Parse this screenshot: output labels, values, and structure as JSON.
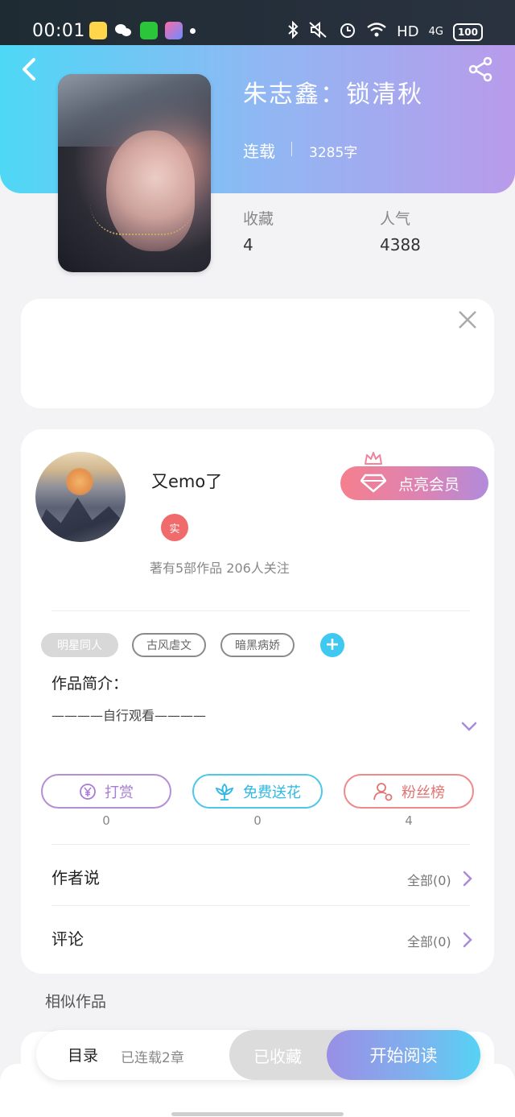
{
  "status_bar": {
    "time": "00:01",
    "network": "HD",
    "signal": "4G",
    "battery": "100"
  },
  "book": {
    "title": "朱志鑫：锁清秋",
    "status": "连载",
    "word_count": "3285字",
    "stats": [
      {
        "label": "收藏",
        "value": "4"
      },
      {
        "label": "人气",
        "value": "4388"
      }
    ]
  },
  "author": {
    "name": "又emo了",
    "badge": "实",
    "meta": "著有5部作品 206人关注",
    "vip_button": "点亮会员"
  },
  "tags": [
    "明星同人",
    "古风虐文",
    "暗黑病娇"
  ],
  "intro": {
    "label": "作品简介：",
    "text": "————自行观看————"
  },
  "actions": [
    {
      "label": "打赏",
      "count": "0",
      "icon": "yen-coin-icon"
    },
    {
      "label": "免费送花",
      "count": "0",
      "icon": "flower-icon"
    },
    {
      "label": "粉丝榜",
      "count": "4",
      "icon": "user-ranking-icon"
    }
  ],
  "rows": [
    {
      "label": "作者说",
      "all": "全部(0)"
    },
    {
      "label": "评论",
      "all": "全部(0)"
    }
  ],
  "similar_label": "相似作品",
  "bottom_bar": {
    "toc": "目录",
    "serial": "已连载2章",
    "collected": "已收藏",
    "read": "开始阅读"
  },
  "colors": {
    "header_start": "#4ed8f6",
    "header_end": "#b99beb",
    "vip": "#f57f8e",
    "accent_blue": "#3fc8f0"
  }
}
